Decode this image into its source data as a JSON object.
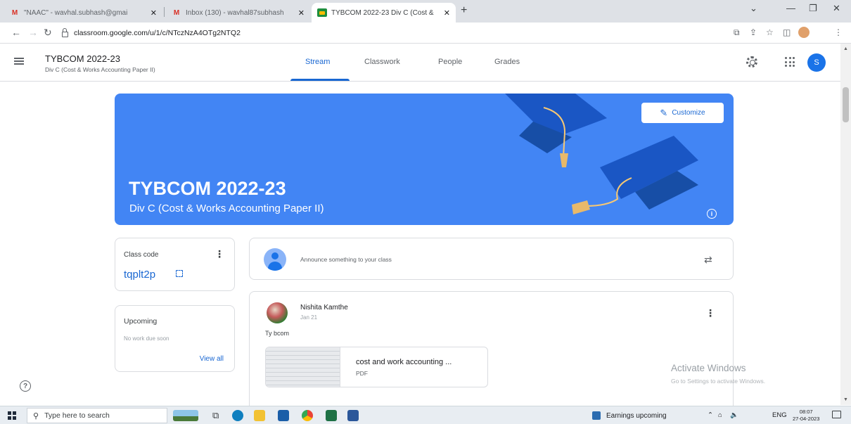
{
  "browser": {
    "tabs": [
      {
        "title": "\"NAAC\" - wavhal.subhash@gmai",
        "icon": "gmail-icon"
      },
      {
        "title": "Inbox (130) - wavhal87subhash",
        "icon": "gmail-icon"
      },
      {
        "title": "TYBCOM 2022-23 Div C (Cost &",
        "icon": "classroom-icon"
      }
    ],
    "url": "classroom.google.com/u/1/c/NTczNzA4OTg2NTQ2",
    "new_tab": "+"
  },
  "header": {
    "class_title": "TYBCOM 2022-23",
    "class_subtitle": "Div C (Cost & Works Accounting Paper II)",
    "tabs": [
      {
        "label": "Stream",
        "active": true
      },
      {
        "label": "Classwork",
        "active": false
      },
      {
        "label": "People",
        "active": false
      },
      {
        "label": "Grades",
        "active": false
      }
    ],
    "avatar_letter": "S",
    "accent": "#1967d2"
  },
  "banner": {
    "title": "TYBCOM 2022-23",
    "subtitle": "Div C (Cost & Works Accounting Paper II)",
    "customize_label": "Customize",
    "color": "#4285f4"
  },
  "class_code": {
    "label": "Class code",
    "value": "tqplt2p"
  },
  "upcoming": {
    "label": "Upcoming",
    "empty_text": "No work due soon",
    "view_all": "View all"
  },
  "announce": {
    "placeholder": "Announce something to your class"
  },
  "post": {
    "author": "Nishita Kamthe",
    "date": "Jan 21",
    "body": "Ty bcom",
    "attachment": {
      "name": "cost and work accounting ...",
      "type": "PDF"
    }
  },
  "watermark": {
    "line1": "Activate Windows",
    "line2": "Go to Settings to activate Windows."
  },
  "taskbar": {
    "search_placeholder": "Type here to search",
    "weather": "Earnings upcoming",
    "lang": "ENG",
    "time": "08:07",
    "date": "27-04-2023"
  }
}
